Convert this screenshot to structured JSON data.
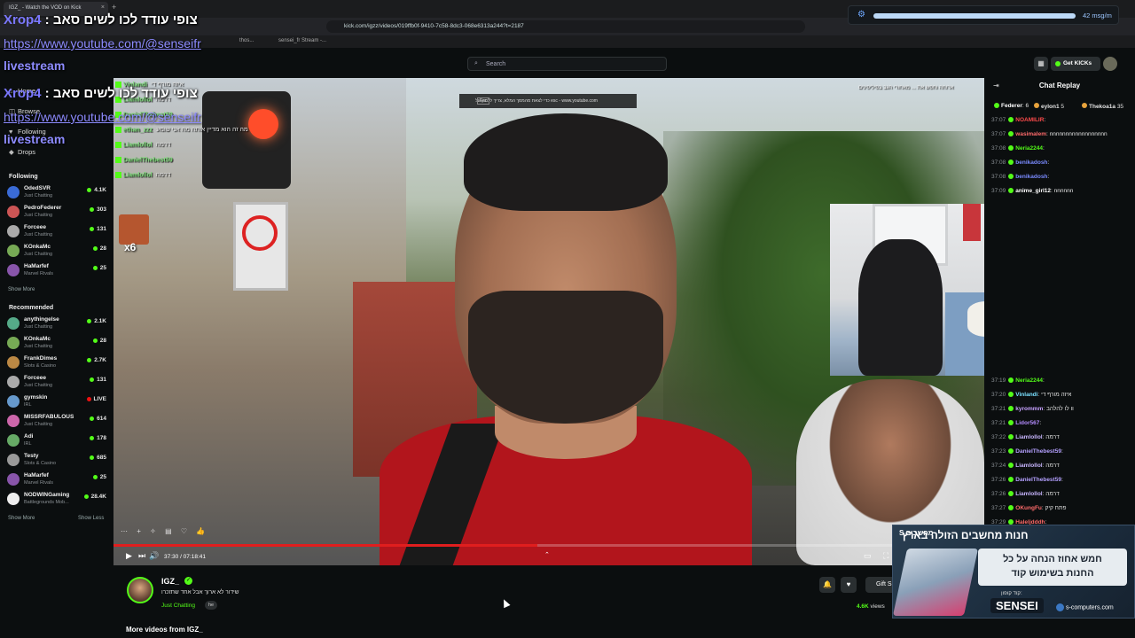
{
  "browser": {
    "tab_title": "IGZ_ - Watch the VOD on Kick",
    "tab_close": "×",
    "new_tab": "+",
    "url": "kick.com/igzz/videos/019ffb0f-9410-7c58-8dc3-068e6313a244?t=2187",
    "bookmarks": [
      "thos...",
      "sensei_fr Stream -..."
    ]
  },
  "audio_widget": {
    "rate": "42 msg/m",
    "level": 0.93
  },
  "overlay": {
    "user": "Xrop4",
    "sep": " : ",
    "message": "צופי עודד לכו לשים סאב",
    "youtube": "https://www.youtube.com/@senseifr",
    "livestream": "livestream"
  },
  "kick_header": {
    "search_placeholder": "Search",
    "get_kicks": "Get KICKs",
    "grid_icon": "▦"
  },
  "sidebar": {
    "nav": [
      {
        "label": "Home",
        "icon": "⌂"
      },
      {
        "label": "Browse",
        "icon": "◫"
      },
      {
        "label": "Following",
        "icon": "♥"
      },
      {
        "label": "Drops",
        "icon": "◆"
      }
    ],
    "following_title": "Following",
    "following": [
      {
        "name": "OdedSVR",
        "cat": "Just Chatting",
        "viewers": "4.1K",
        "color": "#3a6bd6"
      },
      {
        "name": "PedroFederer",
        "cat": "Just Chatting",
        "viewers": "303",
        "color": "#c55"
      },
      {
        "name": "Forceee",
        "cat": "Just Chatting",
        "viewers": "131",
        "color": "#aaa"
      },
      {
        "name": "KOnkaMc",
        "cat": "Just Chatting",
        "viewers": "28",
        "color": "#7a5"
      },
      {
        "name": "HaMarfef",
        "cat": "Marvel Rivals",
        "viewers": "25",
        "color": "#85a"
      }
    ],
    "show_more": "Show More",
    "recommended_title": "Recommended",
    "recommended": [
      {
        "name": "anythingelse",
        "cat": "Just Chatting",
        "viewers": "2.1K",
        "color": "#5a8",
        "live": false
      },
      {
        "name": "KOnkaMc",
        "cat": "Just Chatting",
        "viewers": "28",
        "color": "#7a5",
        "live": false
      },
      {
        "name": "FrankDimes",
        "cat": "Slots & Casino",
        "viewers": "2.7K",
        "color": "#b84",
        "live": false
      },
      {
        "name": "Forceee",
        "cat": "Just Chatting",
        "viewers": "131",
        "color": "#aaa",
        "live": false
      },
      {
        "name": "gymskin",
        "cat": "IRL",
        "viewers": "LIVE",
        "color": "#69c",
        "live": true
      },
      {
        "name": "MISSRFABULOUS",
        "cat": "Just Chatting",
        "viewers": "614",
        "color": "#c6a",
        "live": false
      },
      {
        "name": "Adi",
        "cat": "IRL",
        "viewers": "178",
        "color": "#6a6",
        "live": false
      },
      {
        "name": "Testy",
        "cat": "Slots & Casino",
        "viewers": "685",
        "color": "#999",
        "live": false
      },
      {
        "name": "HaMarfef",
        "cat": "Marvel Rivals",
        "viewers": "25",
        "color": "#85a",
        "live": false
      },
      {
        "name": "NODWINGaming",
        "cat": "Battlegrounds Mob...",
        "viewers": "28.4K",
        "color": "#eee",
        "live": false
      }
    ],
    "show_more2": "Show More",
    "show_less": "Show Less"
  },
  "video": {
    "yt_banner": "כדי לצאת מהמסך המלא, צריך ללחוץ על esc - www.youtube.com",
    "esc": "Esc",
    "top_text": "ארוחה וחפש את ... מאחורי הגב בפיליפינים",
    "chat_overlay": [
      {
        "name": "Vinlandi",
        "msg": "איזה מורף די"
      },
      {
        "name": "Liamlollol",
        "msg": "דרמה"
      },
      {
        "name": "DanielThebest59",
        "msg": ""
      },
      {
        "name": "ethan_zzz",
        "msg": "מה זה הוא מדיין אותה מה אני שומע"
      },
      {
        "name": "Liamlollol",
        "msg": "דרמה"
      },
      {
        "name": "DanielThebest59",
        "msg": ""
      },
      {
        "name": "Liamlollol",
        "msg": "דרמה"
      }
    ],
    "emote_count": "x6",
    "time": "37:30 / 07:18:41",
    "progress": 0.487
  },
  "player_icons": {
    "play": "▶",
    "skip": "⏭",
    "volume": "🔊",
    "theater": "▭",
    "fullscreen": "⛶",
    "chevron": "⌃"
  },
  "reactions": [
    "⋯",
    "+",
    "✧",
    "▤",
    "♡",
    "👍"
  ],
  "channel": {
    "name": "IGZ_",
    "title": "שידור לא ארוך אבל אחד שתזכרו",
    "category": "Just Chatting",
    "tag": "he",
    "views_count": "4.6K",
    "views_label": "views",
    "more_videos": "More videos from IGZ_"
  },
  "actions": {
    "bell": "🔔",
    "heart": "♥",
    "gift": "Gift S"
  },
  "chat": {
    "title": "Chat Replay",
    "top_messages": [
      {
        "time": "",
        "name": "Federer",
        "color": "#fff",
        "msg": "6"
      },
      {
        "time": "37:07",
        "name": "NOAMILIR",
        "color": "#ff4b4b",
        "msg": ""
      },
      {
        "time": "37:07",
        "name": "wasimalem",
        "color": "#ff6b6b",
        "msg": "nnnnnnnnnnnnnnnnnn"
      },
      {
        "time": "37:08",
        "name": "Neria2244",
        "color": "#53fc18",
        "msg": ""
      },
      {
        "time": "37:08",
        "name": "benikadosh",
        "color": "#7a8bff",
        "msg": ""
      },
      {
        "time": "37:08",
        "name": "benikadosh",
        "color": "#7a8bff",
        "msg": ""
      },
      {
        "time": "37:09",
        "name": "anime_girl12",
        "color": "#fff",
        "msg": "nnnnnn"
      }
    ],
    "top_users2": [
      {
        "name": "eylon1",
        "num": "5"
      },
      {
        "name": "Thekoa1a",
        "num": "35"
      }
    ],
    "messages": [
      {
        "time": "37:19",
        "name": "Neria2244",
        "color": "#53fc18",
        "msg": ""
      },
      {
        "time": "37:20",
        "name": "Vinlandi",
        "color": "#7ae0ff",
        "msg": "איזה מורף די"
      },
      {
        "time": "37:21",
        "name": "kyrommm",
        "color": "#c7a2ff",
        "msg": "וו לו להלהב"
      },
      {
        "time": "37:21",
        "name": "Lidor567",
        "color": "#b48cff",
        "msg": ""
      },
      {
        "time": "37:22",
        "name": "Liamlollol",
        "color": "#c8b6ff",
        "msg": "דרמה"
      },
      {
        "time": "37:23",
        "name": "DanielThebest59",
        "color": "#b4a0ff",
        "msg": ""
      },
      {
        "time": "37:24",
        "name": "Liamlollol",
        "color": "#c8b6ff",
        "msg": "דרמה"
      },
      {
        "time": "37:26",
        "name": "DanielThebest59",
        "color": "#b4a0ff",
        "msg": ""
      },
      {
        "time": "37:26",
        "name": "Liamlollol",
        "color": "#c8b6ff",
        "msg": "דרמה"
      },
      {
        "time": "37:27",
        "name": "OKungFu",
        "color": "#ff6b6b",
        "msg": "פתח קיק"
      },
      {
        "time": "37:29",
        "name": "Haleljdddh",
        "color": "#ff6b6b",
        "msg": ""
      },
      {
        "time": "37:30",
        "name": "Liamlollol",
        "color": "#c8b6ff",
        "msg": "דרמה"
      }
    ]
  },
  "ad": {
    "title": "חנות מחשבים הזולה בארץ",
    "brand": "S מחשבים",
    "offer_line1": "חמש אחוז הנחה על כל",
    "offer_line2": "החנות בשימוש קוד",
    "code_label": "קוד קופון:",
    "code": "SENSEI",
    "site": "s-computers.com"
  }
}
